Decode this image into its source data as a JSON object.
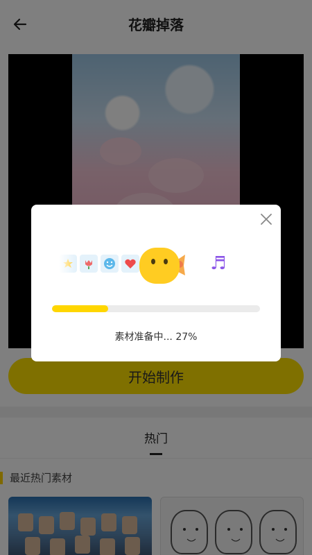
{
  "header": {
    "title": "花瓣掉落"
  },
  "actions": {
    "start_label": "开始制作"
  },
  "tabs": [
    {
      "label": "热门"
    }
  ],
  "section": {
    "title": "最近热门素材"
  },
  "modal": {
    "status_text": "素材准备中... 27%",
    "progress": 0.27,
    "icons": [
      "tulip-icon",
      "smiley-icon",
      "heart-icon",
      "candy-icon",
      "music-note-icon"
    ]
  },
  "colors": {
    "accent": "#ffe000",
    "progress": "#ffd600",
    "music": "#8b55e8"
  }
}
